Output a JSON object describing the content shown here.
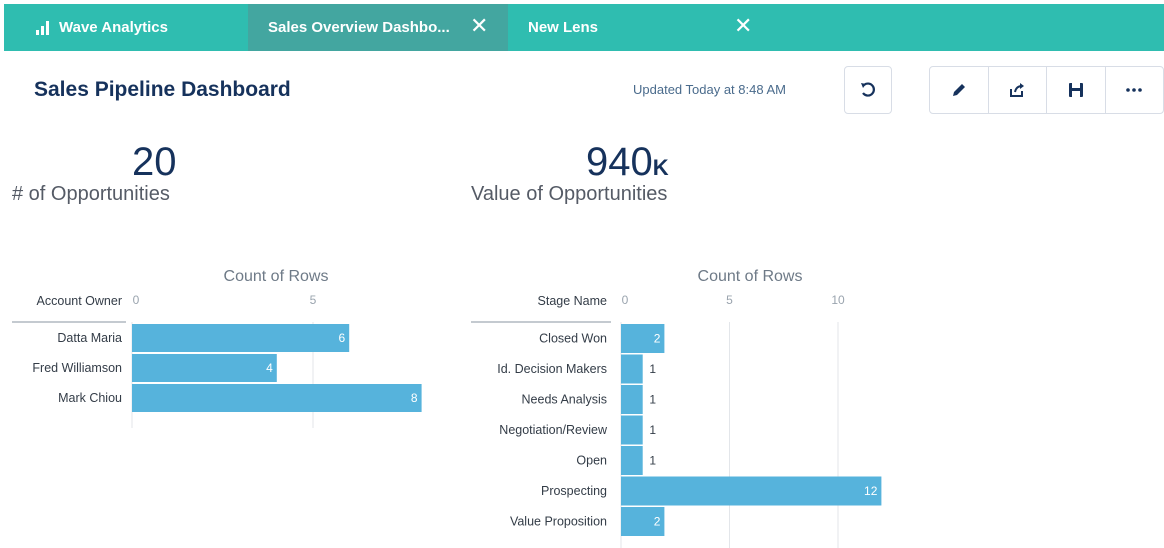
{
  "tabs": {
    "home_label": "Wave Analytics",
    "active_label": "Sales Overview Dashbo...",
    "lens_label": "New Lens"
  },
  "header": {
    "title": "Sales Pipeline Dashboard",
    "updated": "Updated Today at 8:48 AM"
  },
  "toolbar": {
    "icons": [
      "undo-icon",
      "edit-icon",
      "share-icon",
      "save-icon",
      "more-icon"
    ]
  },
  "metrics": [
    {
      "value": "20",
      "unit": "",
      "label": "# of Opportunities"
    },
    {
      "value": "940",
      "unit": "K",
      "label": "Value of Opportunities"
    }
  ],
  "colors": {
    "tabbar": "#2fbdb0",
    "tab_active": "#43a6a0",
    "bar": "#56b3dc",
    "title": "#16325c"
  },
  "chart_data": [
    {
      "type": "bar",
      "orientation": "horizontal",
      "title": "Count of Rows",
      "dimension_label": "Account Owner",
      "categories": [
        "Datta Maria",
        "Fred Williamson",
        "Mark Chiou"
      ],
      "values": [
        6,
        4,
        8
      ],
      "xlim": [
        0,
        8
      ],
      "ticks": [
        0,
        5
      ]
    },
    {
      "type": "bar",
      "orientation": "horizontal",
      "title": "Count of Rows",
      "dimension_label": "Stage Name",
      "categories": [
        "Closed Won",
        "Id. Decision Makers",
        "Needs Analysis",
        "Negotiation/Review",
        "Open",
        "Prospecting",
        "Value Proposition"
      ],
      "values": [
        2,
        1,
        1,
        1,
        1,
        12,
        2
      ],
      "xlim": [
        0,
        12
      ],
      "ticks": [
        0,
        5,
        10
      ]
    }
  ]
}
